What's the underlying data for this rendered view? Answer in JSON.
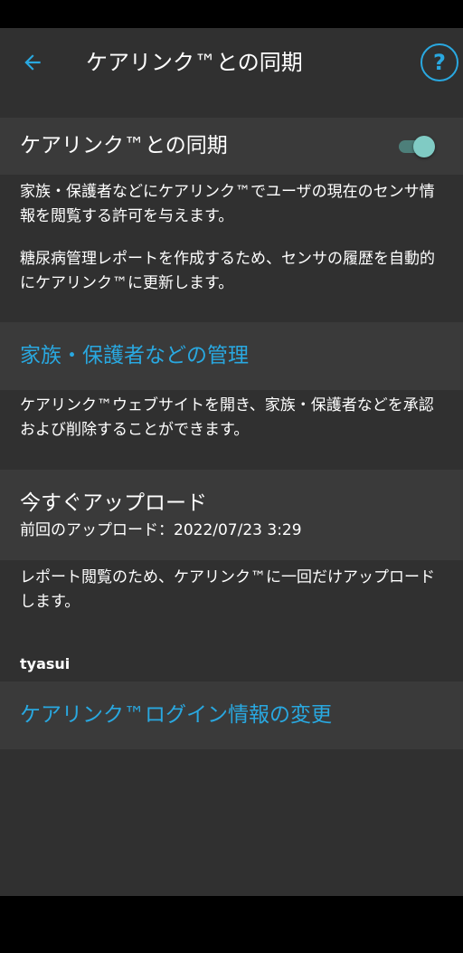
{
  "header": {
    "title": "ケアリンク™との同期",
    "back_icon": "arrow-left-icon",
    "help_icon": "help-circle-icon",
    "help_glyph": "?",
    "accent_color": "#29a8e0"
  },
  "sync": {
    "label": "ケアリンク™との同期",
    "toggle_on": true,
    "desc1": "家族・保護者などにケアリンク™でユーザの現在のセンサ情報を閲覧する許可を与えます。",
    "desc2": "糖尿病管理レポートを作成するため、センサの履歴を自動的にケアリンク™に更新します。"
  },
  "manage": {
    "link": "家族・保護者などの管理",
    "desc": "ケアリンク™ウェブサイトを開き、家族・保護者などを承認および削除することができます。"
  },
  "upload": {
    "title": "今すぐアップロード",
    "last_upload": "前回のアップロード：2022/07/23 3:29",
    "desc": "レポート閲覧のため、ケアリンク™に一回だけアップロードします。"
  },
  "account": {
    "username": "tyasui",
    "change_login_link": "ケアリンク™ログイン情報の変更"
  }
}
